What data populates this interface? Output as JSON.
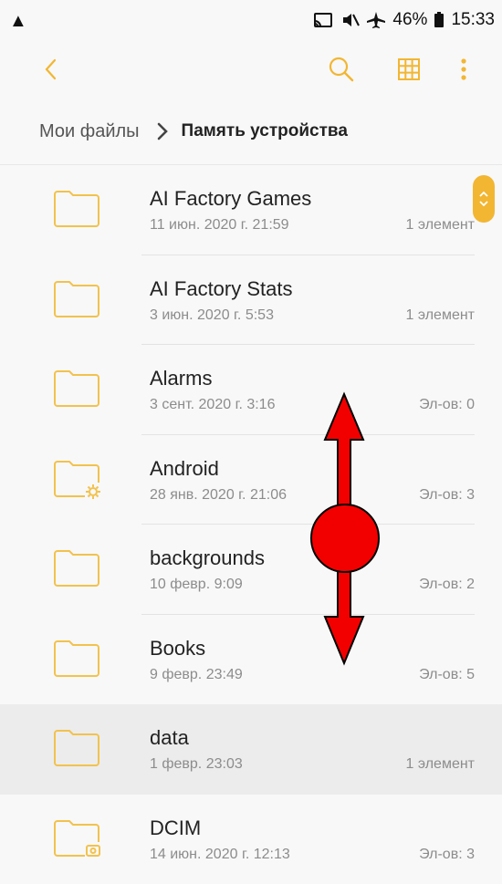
{
  "status_bar": {
    "battery": "46%",
    "time": "15:33"
  },
  "toolbar": {
    "back_icon": "chevron-left-icon",
    "search_icon": "search-icon",
    "grid_icon": "grid-view-icon",
    "more_icon": "more-vert-icon"
  },
  "breadcrumb": {
    "root": "Мои файлы",
    "current": "Память устройства"
  },
  "accent_color": "#f2b632",
  "files": [
    {
      "name": "AI Factory Games",
      "date": "11 июн. 2020 г. 21:59",
      "count": "1 элемент",
      "icon": "folder-icon"
    },
    {
      "name": "AI Factory Stats",
      "date": "3 июн. 2020 г. 5:53",
      "count": "1 элемент",
      "icon": "folder-icon"
    },
    {
      "name": "Alarms",
      "date": "3 сент. 2020 г. 3:16",
      "count": "Эл-ов: 0",
      "icon": "folder-icon"
    },
    {
      "name": "Android",
      "date": "28 янв. 2020 г. 21:06",
      "count": "Эл-ов: 3",
      "icon": "system-folder-icon"
    },
    {
      "name": "backgrounds",
      "date": "10 февр. 9:09",
      "count": "Эл-ов: 2",
      "icon": "folder-icon"
    },
    {
      "name": "Books",
      "date": "9 февр. 23:49",
      "count": "Эл-ов: 5",
      "icon": "folder-icon"
    },
    {
      "name": "data",
      "date": "1 февр. 23:03",
      "count": "1 элемент",
      "icon": "folder-icon"
    },
    {
      "name": "DCIM",
      "date": "14 июн. 2020 г. 12:13",
      "count": "Эл-ов: 3",
      "icon": "camera-folder-icon"
    }
  ],
  "gesture_hint": "swipe-vertical-icon"
}
